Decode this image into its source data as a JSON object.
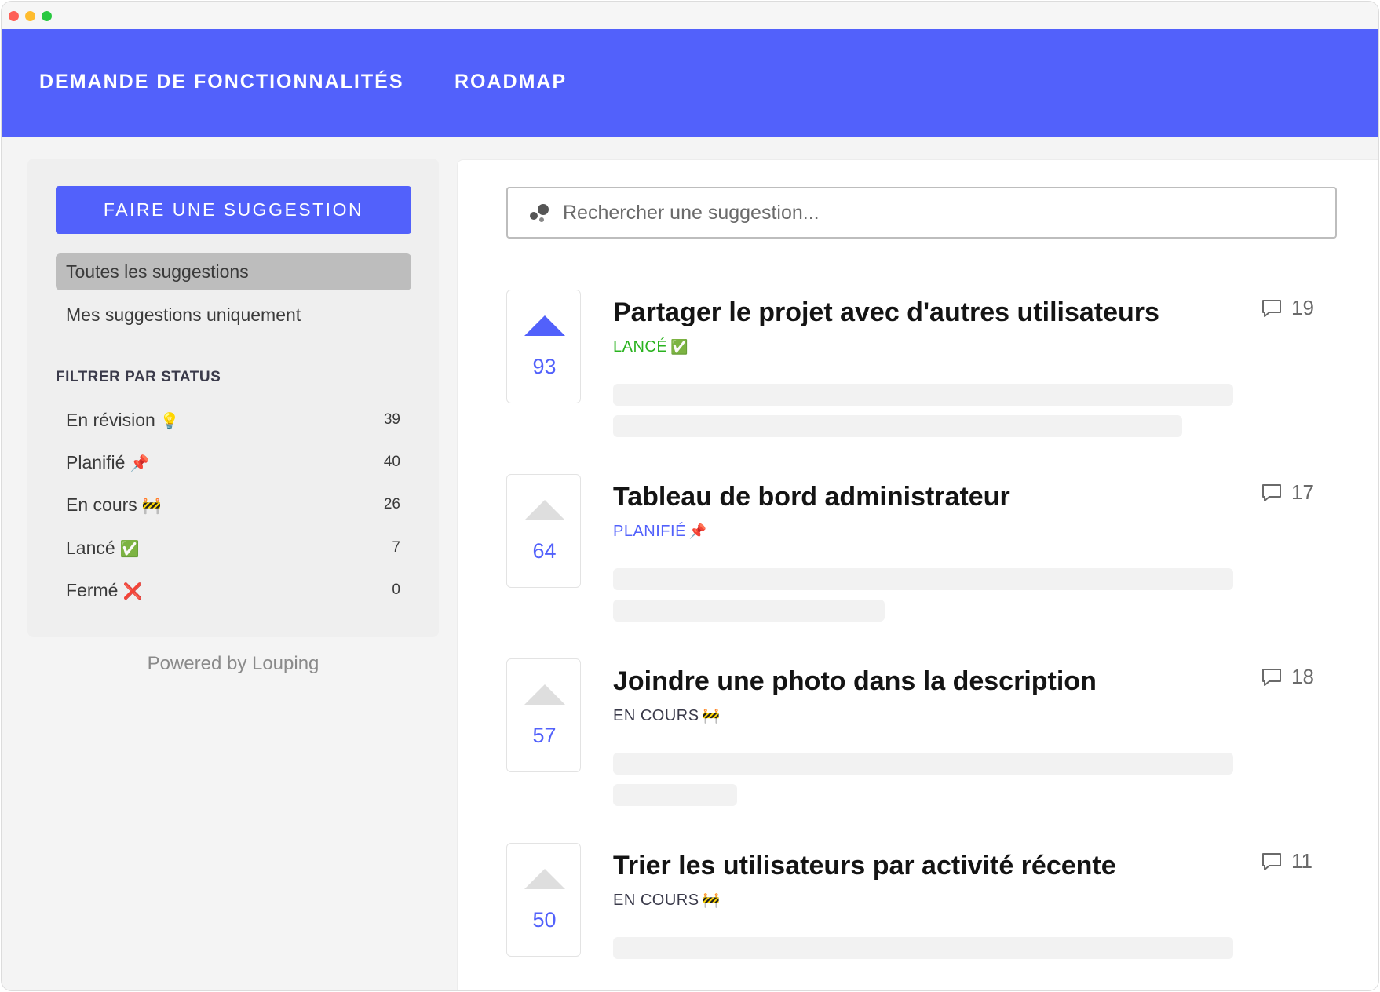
{
  "nav": {
    "feature_requests": "DEMANDE DE FONCTIONNALITÉS",
    "roadmap": "ROADMAP"
  },
  "sidebar": {
    "suggest_button": "FAIRE UNE SUGGESTION",
    "all_suggestions": "Toutes les suggestions",
    "my_suggestions": "Mes suggestions uniquement",
    "filter_title": "FILTRER PAR STATUS",
    "statuses": [
      {
        "label": "En révision",
        "emoji": "💡",
        "count": "39"
      },
      {
        "label": "Planifié",
        "emoji": "📌",
        "count": "40"
      },
      {
        "label": "En cours",
        "emoji": "🚧",
        "count": "26"
      },
      {
        "label": "Lancé",
        "emoji": "✅",
        "count": "7"
      },
      {
        "label": "Fermé",
        "emoji": "❌",
        "count": "0"
      }
    ],
    "powered_by": "Powered by Louping"
  },
  "search": {
    "placeholder": "Rechercher une suggestion..."
  },
  "suggestions": [
    {
      "votes": "93",
      "title": "Partager le projet avec d'autres utilisateurs",
      "status": "LANCÉ",
      "status_emoji": "✅",
      "comments": "19",
      "upvoted": true,
      "status_color": "#2ab31f"
    },
    {
      "votes": "64",
      "title": "Tableau de bord administrateur",
      "status": "PLANIFIÉ",
      "status_emoji": "📌",
      "comments": "17",
      "upvoted": false,
      "status_color": "#5261fb"
    },
    {
      "votes": "57",
      "title": "Joindre une photo dans la description",
      "status": "EN COURS",
      "status_emoji": "🚧",
      "comments": "18",
      "upvoted": false,
      "status_color": "#3a3a4a"
    },
    {
      "votes": "50",
      "title": "Trier les utilisateurs par activité récente",
      "status": "EN COURS",
      "status_emoji": "🚧",
      "comments": "11",
      "upvoted": false,
      "status_color": "#3a3a4a"
    }
  ],
  "colors": {
    "accent": "#5261fb",
    "active_item_bg": "#bdbdbd"
  }
}
